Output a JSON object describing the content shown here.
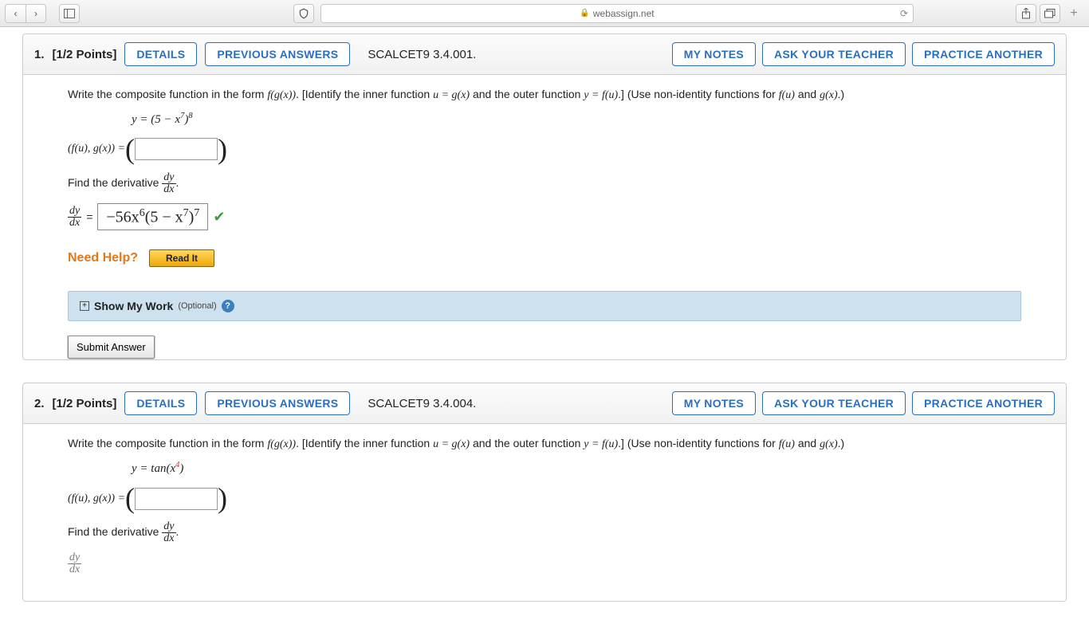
{
  "browser": {
    "url": "webassign.net"
  },
  "buttons": {
    "details": "DETAILS",
    "previous": "PREVIOUS ANSWERS",
    "mynotes": "MY NOTES",
    "askteacher": "ASK YOUR TEACHER",
    "practice": "PRACTICE ANOTHER",
    "readit": "Read It",
    "submit": "Submit Answer"
  },
  "q1": {
    "num": "1.",
    "pts": "[1/2 Points]",
    "code": "SCALCET9 3.4.001.",
    "prompt_pre": "Write the composite function in the form ",
    "prompt_mid1": ". [Identify the inner function ",
    "prompt_mid2": " and the outer function ",
    "prompt_mid3": ".] (Use non-identity functions for ",
    "prompt_mid4": " and ",
    "prompt_end": ".)",
    "equation_label": "y = ",
    "eq_base": "(5 − x",
    "eq_inner_exp": "7",
    "eq_close": ")",
    "eq_outer_exp": "8",
    "tuple_label": "(f(u), g(x)) = ",
    "deriv_prompt": "Find the derivative ",
    "dy": "dy",
    "dx": "dx",
    "answer": "−56x",
    "ans_exp1": "6",
    "ans_mid": "(5 − x",
    "ans_exp2": "7",
    "ans_close": ")",
    "ans_exp3": "7",
    "needhelp": "Need Help?",
    "showwork": "Show My Work",
    "optional": "(Optional)"
  },
  "q2": {
    "num": "2.",
    "pts": "[1/2 Points]",
    "code": "SCALCET9 3.4.004.",
    "equation_label": "y = ",
    "eq_main": "tan(x",
    "eq_exp": "4",
    "eq_close": ")",
    "tuple_label": "(f(u), g(x)) = ",
    "deriv_prompt": "Find the derivative "
  },
  "math": {
    "fgx": "f(g(x))",
    "u_eq": "u = g(x)",
    "y_eq": "y = f(u)",
    "fu": "f(u)",
    "gx": "g(x)",
    "eq_sign": " = "
  }
}
